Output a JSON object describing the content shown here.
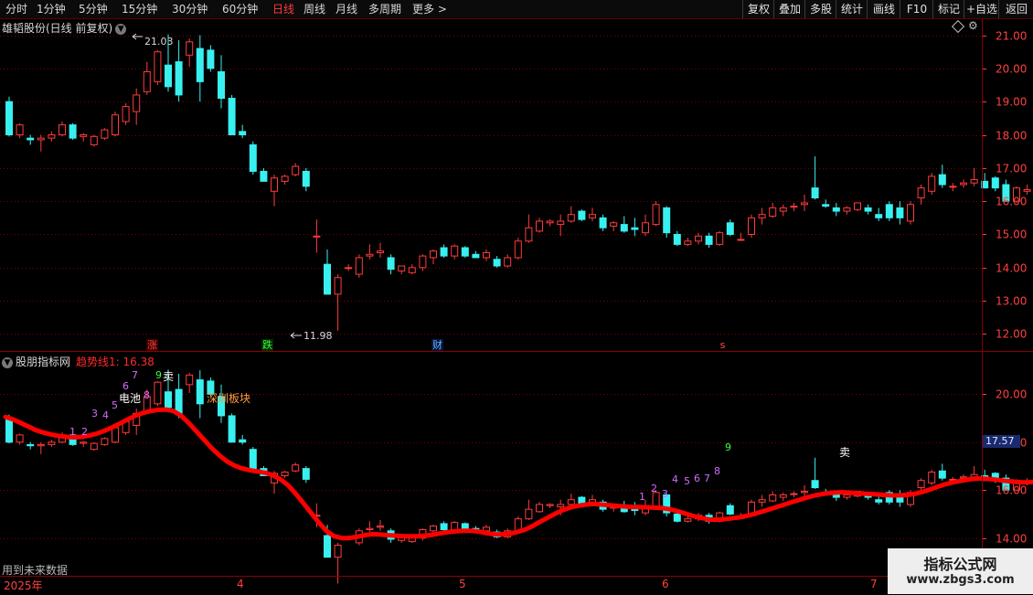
{
  "toolbar": {
    "periods": [
      "分时",
      "1分钟",
      "5分钟",
      "15分钟",
      "30分钟",
      "60分钟",
      "日线",
      "周线",
      "月线",
      "多周期",
      "更多 >"
    ],
    "active_period": "日线",
    "right_buttons": [
      "复权",
      "叠加",
      "多股",
      "统计",
      "画线",
      "F10",
      "+自选",
      "返回"
    ],
    "mark_label": "标记"
  },
  "main_chart": {
    "title": "雄韬股份(日线 前复权)",
    "high_label": "21.03",
    "low_label": "11.98",
    "badges": {
      "zhang": "涨",
      "die": "跌",
      "cai": "财",
      "s": "s"
    }
  },
  "indicator": {
    "name": "股朋指标网",
    "trend_label": "趋势线1: 16.38",
    "annotations": {
      "dianchi": "电池",
      "sell1": "卖",
      "sell2": "卖",
      "board": "深圳板块"
    },
    "future_note": "用到未来数据",
    "current_price_tag": "17.57"
  },
  "date_axis": [
    "2025年",
    "4",
    "5",
    "6",
    "7"
  ],
  "watermark": {
    "title": "指标公式网",
    "url": "www.zbgs3.com"
  },
  "colors": {
    "up": "#ff3b3b",
    "down": "#39f0f0",
    "trend": "#ff0000",
    "grid": "#7a0000",
    "axis": "#ff4040"
  },
  "chart_data": [
    {
      "type": "candlestick",
      "title": "雄韬股份(日线 前复权)",
      "ylim": [
        11.6,
        21.4
      ],
      "y_ticks": [
        12.0,
        13.0,
        14.0,
        15.0,
        16.0,
        17.0,
        18.0,
        19.0,
        20.0,
        21.0
      ],
      "x_labels": [
        "2025年",
        "4",
        "5",
        "6",
        "7"
      ],
      "ohlc": [
        [
          19.0,
          19.15,
          17.95,
          18.0
        ],
        [
          18.0,
          18.35,
          17.9,
          18.3
        ],
        [
          17.9,
          18.0,
          17.7,
          17.85
        ],
        [
          17.85,
          18.0,
          17.5,
          17.9
        ],
        [
          17.9,
          18.1,
          17.8,
          18.0
        ],
        [
          18.0,
          18.4,
          17.95,
          18.3
        ],
        [
          18.3,
          18.35,
          17.85,
          17.9
        ],
        [
          17.95,
          18.05,
          17.8,
          18.0
        ],
        [
          17.7,
          18.0,
          17.65,
          17.95
        ],
        [
          17.9,
          18.2,
          17.85,
          18.15
        ],
        [
          18.0,
          18.7,
          17.95,
          18.6
        ],
        [
          18.4,
          18.95,
          18.3,
          18.85
        ],
        [
          18.7,
          19.4,
          18.3,
          19.2
        ],
        [
          19.3,
          20.2,
          19.2,
          19.9
        ],
        [
          19.6,
          20.55,
          19.5,
          20.5
        ],
        [
          20.1,
          21.03,
          19.3,
          19.45
        ],
        [
          20.2,
          20.85,
          19.0,
          19.2
        ],
        [
          20.4,
          20.9,
          20.05,
          20.8
        ],
        [
          20.6,
          21.0,
          19.0,
          19.6
        ],
        [
          20.55,
          20.7,
          19.9,
          20.0
        ],
        [
          19.9,
          20.4,
          18.8,
          19.1
        ],
        [
          19.1,
          19.2,
          18.0,
          18.0
        ],
        [
          18.1,
          18.3,
          17.9,
          18.0
        ],
        [
          17.7,
          17.8,
          16.8,
          16.9
        ],
        [
          16.9,
          17.0,
          16.6,
          16.6
        ],
        [
          16.3,
          16.8,
          15.85,
          16.7
        ],
        [
          16.6,
          16.8,
          16.5,
          16.75
        ],
        [
          16.8,
          17.15,
          16.75,
          17.05
        ],
        [
          16.9,
          17.0,
          16.3,
          16.45
        ],
        [
          14.95,
          15.45,
          14.45,
          14.95
        ],
        [
          14.1,
          14.55,
          13.2,
          13.2
        ],
        [
          13.2,
          13.8,
          12.1,
          13.7
        ],
        [
          14.0,
          14.1,
          13.9,
          14.0
        ],
        [
          13.8,
          14.4,
          13.7,
          14.3
        ],
        [
          14.35,
          14.7,
          14.25,
          14.4
        ],
        [
          14.45,
          14.75,
          14.3,
          14.5
        ],
        [
          14.3,
          14.4,
          13.8,
          13.95
        ],
        [
          13.9,
          14.05,
          13.8,
          14.05
        ],
        [
          13.85,
          14.1,
          13.8,
          14.0
        ],
        [
          14.0,
          14.4,
          13.9,
          14.35
        ],
        [
          14.3,
          14.55,
          14.1,
          14.5
        ],
        [
          14.6,
          14.7,
          14.3,
          14.35
        ],
        [
          14.35,
          14.7,
          14.25,
          14.65
        ],
        [
          14.6,
          14.65,
          14.3,
          14.35
        ],
        [
          14.4,
          14.5,
          14.3,
          14.3
        ],
        [
          14.3,
          14.55,
          14.2,
          14.45
        ],
        [
          14.25,
          14.35,
          14.0,
          14.05
        ],
        [
          14.05,
          14.4,
          14.0,
          14.3
        ],
        [
          14.3,
          14.9,
          14.25,
          14.8
        ],
        [
          14.8,
          15.6,
          14.75,
          15.2
        ],
        [
          15.1,
          15.5,
          15.05,
          15.4
        ],
        [
          15.35,
          15.45,
          15.25,
          15.4
        ],
        [
          15.3,
          15.6,
          14.95,
          15.4
        ],
        [
          15.4,
          15.85,
          15.35,
          15.6
        ],
        [
          15.7,
          15.75,
          15.4,
          15.45
        ],
        [
          15.5,
          15.8,
          15.4,
          15.6
        ],
        [
          15.5,
          15.6,
          15.1,
          15.2
        ],
        [
          15.25,
          15.4,
          15.1,
          15.35
        ],
        [
          15.3,
          15.55,
          15.05,
          15.1
        ],
        [
          15.2,
          15.5,
          14.95,
          15.15
        ],
        [
          15.05,
          15.6,
          14.95,
          15.35
        ],
        [
          15.3,
          16.0,
          15.25,
          15.9
        ],
        [
          15.8,
          15.85,
          14.9,
          15.05
        ],
        [
          15.0,
          15.1,
          14.65,
          14.7
        ],
        [
          14.7,
          14.9,
          14.65,
          14.8
        ],
        [
          14.8,
          15.05,
          14.7,
          14.95
        ],
        [
          14.95,
          15.05,
          14.6,
          14.7
        ],
        [
          14.7,
          15.1,
          14.65,
          15.05
        ],
        [
          15.35,
          15.45,
          14.95,
          15.0
        ],
        [
          14.85,
          15.05,
          14.8,
          14.85
        ],
        [
          15.0,
          15.6,
          14.9,
          15.5
        ],
        [
          15.5,
          15.8,
          15.3,
          15.6
        ],
        [
          15.55,
          15.95,
          15.5,
          15.8
        ],
        [
          15.7,
          15.9,
          15.55,
          15.8
        ],
        [
          15.85,
          15.95,
          15.7,
          15.85
        ],
        [
          15.9,
          16.2,
          15.7,
          15.95
        ],
        [
          16.4,
          17.35,
          16.05,
          16.1
        ],
        [
          15.9,
          16.05,
          15.8,
          15.85
        ],
        [
          15.8,
          15.95,
          15.55,
          15.7
        ],
        [
          15.7,
          15.85,
          15.6,
          15.8
        ],
        [
          15.75,
          15.95,
          15.7,
          15.95
        ],
        [
          15.8,
          15.9,
          15.6,
          15.7
        ],
        [
          15.6,
          15.8,
          15.4,
          15.5
        ],
        [
          15.9,
          16.0,
          15.4,
          15.5
        ],
        [
          15.8,
          16.0,
          15.3,
          15.5
        ],
        [
          15.4,
          16.0,
          15.3,
          15.9
        ],
        [
          16.1,
          16.5,
          15.9,
          16.4
        ],
        [
          16.3,
          16.85,
          16.2,
          16.75
        ],
        [
          16.8,
          17.1,
          16.4,
          16.5
        ],
        [
          16.45,
          16.55,
          16.3,
          16.45
        ],
        [
          16.5,
          16.65,
          16.4,
          16.55
        ],
        [
          16.55,
          17.0,
          16.45,
          16.65
        ],
        [
          16.6,
          16.85,
          16.4,
          16.4
        ],
        [
          16.7,
          16.75,
          16.3,
          16.4
        ],
        [
          16.5,
          16.65,
          16.0,
          16.0
        ],
        [
          16.0,
          16.45,
          15.95,
          16.4
        ],
        [
          16.3,
          16.5,
          16.2,
          16.35
        ],
        [
          16.4,
          16.6,
          16.35,
          16.55
        ],
        [
          16.55,
          17.05,
          16.45,
          16.7
        ]
      ]
    },
    {
      "type": "line",
      "title": "股朋指标网",
      "series_label": "趋势线1: 16.38",
      "ylim": [
        12.5,
        21.5
      ],
      "y_ticks": [
        14.0,
        16.0,
        18.0,
        20.0
      ],
      "trend": [
        19.05,
        18.95,
        18.8,
        18.65,
        18.5,
        18.4,
        18.32,
        18.26,
        18.22,
        18.2,
        18.22,
        18.28,
        18.36,
        18.48,
        18.62,
        18.78,
        18.95,
        19.1,
        19.22,
        19.3,
        19.35,
        19.36,
        19.3,
        19.1,
        18.8,
        18.45,
        18.1,
        17.75,
        17.45,
        17.2,
        17.02,
        16.9,
        16.83,
        16.78,
        16.72,
        16.62,
        16.45,
        16.2,
        15.85,
        15.45,
        15.05,
        14.65,
        14.3,
        14.08,
        14.0,
        14.0,
        14.05,
        14.12,
        14.16,
        14.15,
        14.12,
        14.1,
        14.08,
        14.07,
        14.08,
        14.1,
        14.14,
        14.2,
        14.25,
        14.28,
        14.3,
        14.3,
        14.27,
        14.2,
        14.16,
        14.15,
        14.18,
        14.25,
        14.35,
        14.5,
        14.68,
        14.85,
        15.02,
        15.17,
        15.28,
        15.35,
        15.4,
        15.42,
        15.4,
        15.37,
        15.34,
        15.32,
        15.3,
        15.29,
        15.28,
        15.27,
        15.25,
        15.2,
        15.12,
        15.02,
        14.92,
        14.84,
        14.78,
        14.76,
        14.78,
        14.82,
        14.86,
        14.92,
        15.0,
        15.1,
        15.2,
        15.3,
        15.4,
        15.5,
        15.6,
        15.7,
        15.78,
        15.84,
        15.88,
        15.9,
        15.9,
        15.88,
        15.86,
        15.84,
        15.82,
        15.8,
        15.78,
        15.78,
        15.8,
        15.84,
        15.92,
        16.02,
        16.14,
        16.24,
        16.32,
        16.38,
        16.44,
        16.48,
        16.48,
        16.46,
        16.42,
        16.38,
        16.35,
        16.32,
        16.33,
        16.35,
        16.37,
        16.38
      ],
      "count_labels": [
        "1",
        "2",
        "3",
        "4",
        "5",
        "6",
        "7",
        "8",
        "9",
        "1",
        "2",
        "3",
        "4",
        "5",
        "6",
        "7",
        "8",
        "9"
      ]
    }
  ]
}
